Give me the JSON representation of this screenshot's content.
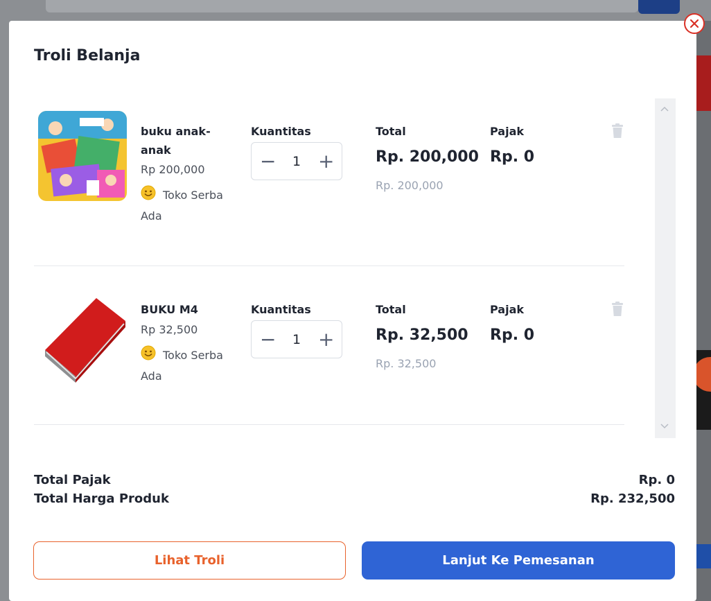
{
  "modal": {
    "title": "Troli Belanja"
  },
  "columns": {
    "quantity": "Kuantitas",
    "total": "Total",
    "tax": "Pajak"
  },
  "items": [
    {
      "name": "buku anak-anak",
      "price": "Rp 200,000",
      "shop": "Toko Serba Ada",
      "qty": "1",
      "total": "Rp. 200,000",
      "subtotal": "Rp. 200,000",
      "tax": "Rp. 0"
    },
    {
      "name": "BUKU M4",
      "price": "Rp 32,500",
      "shop": "Toko Serba Ada",
      "qty": "1",
      "total": "Rp. 32,500",
      "subtotal": "Rp. 32,500",
      "tax": "Rp. 0"
    }
  ],
  "summary": {
    "tax_label": "Total Pajak",
    "tax_value": "Rp. 0",
    "price_label": "Total Harga Produk",
    "price_value": "Rp. 232,500"
  },
  "actions": {
    "view_cart": "Lihat Troli",
    "checkout": "Lanjut Ke Pemesanan"
  },
  "colors": {
    "primary": "#2f64d5",
    "accent_orange": "#e8622c",
    "close_red": "#d93025"
  },
  "icons": [
    "close-icon",
    "minus-icon",
    "plus-icon",
    "trash-icon",
    "smiley-icon",
    "chevron-up-icon",
    "chevron-down-icon"
  ]
}
